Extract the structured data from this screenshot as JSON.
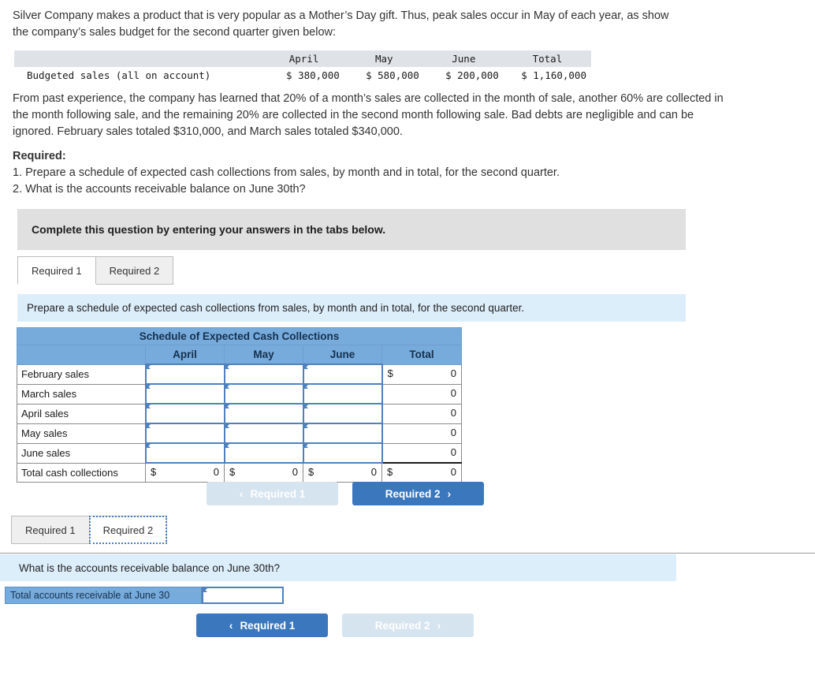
{
  "problem": {
    "intro": "Silver Company makes a product that is very popular as a Mother’s Day gift. Thus, peak sales occur in May of each year, as show\nthe company’s sales budget for the second quarter given below:",
    "paragraph": "From past experience, the company has learned that 20% of a month’s sales are collected in the month of sale, another 60% are collected in the month following sale, and the remaining 20% are collected in the second month following sale. Bad debts are negligible and can be ignored. February sales totaled $310,000, and March sales totaled $340,000.",
    "required_heading": "Required:",
    "required_1": "1. Prepare a schedule of expected cash collections from sales, by month and in total, for the second quarter.",
    "required_2": "2. What is the accounts receivable balance on June 30th?"
  },
  "budget_table": {
    "headers": [
      "",
      "April",
      "May",
      "June",
      "Total"
    ],
    "row_label": "Budgeted sales (all on account)",
    "values": [
      "$ 380,000",
      "$ 580,000",
      "$ 200,000",
      "$ 1,160,000"
    ]
  },
  "banner": {
    "text": "Complete this question by entering your answers in the tabs below."
  },
  "tabs_top": {
    "tab1": "Required 1",
    "tab2": "Required 2"
  },
  "tabs_bottom": {
    "tab1": "Required 1",
    "tab2": "Required 2"
  },
  "prompt_top": "Prepare a schedule of expected cash collections from sales, by month and in total, for the second quarter.",
  "prompt_bottom": "What is the accounts receivable balance on June 30th?",
  "schedule": {
    "title": "Schedule of Expected Cash Collections",
    "columns": [
      "",
      "April",
      "May",
      "June",
      "Total"
    ],
    "rows": [
      {
        "label": "February sales",
        "april": "",
        "may": "",
        "june": "",
        "total_dollar": "$",
        "total": "0"
      },
      {
        "label": "March sales",
        "april": "",
        "may": "",
        "june": "",
        "total_dollar": "",
        "total": "0"
      },
      {
        "label": "April sales",
        "april": "",
        "may": "",
        "june": "",
        "total_dollar": "",
        "total": "0"
      },
      {
        "label": "May sales",
        "april": "",
        "may": "",
        "june": "",
        "total_dollar": "",
        "total": "0"
      },
      {
        "label": "June sales",
        "april": "",
        "may": "",
        "june": "",
        "total_dollar": "",
        "total": "0"
      }
    ],
    "total_row": {
      "label": "Total cash collections",
      "april_dollar": "$",
      "april": "0",
      "may_dollar": "$",
      "may": "0",
      "june_dollar": "$",
      "june": "0",
      "total_dollar": "$",
      "total": "0"
    }
  },
  "answer_row": {
    "label": "Total accounts receivable at June 30",
    "value": ""
  },
  "nav_top": {
    "prev_label": "Required 1",
    "next_label": "Required 2",
    "prev_chevron": "‹",
    "next_chevron": "›"
  },
  "nav_bottom": {
    "prev_label": "Required 1",
    "next_label": "Required 2",
    "prev_chevron": "‹",
    "next_chevron": "›"
  },
  "colors": {
    "header_blue": "#77ABDC",
    "button_blue": "#3a77bd",
    "button_disabled": "#d6e4f0",
    "prompt_blue": "#ddeefb",
    "banner_gray": "#e0e0e0",
    "input_border": "#4e81bd"
  }
}
